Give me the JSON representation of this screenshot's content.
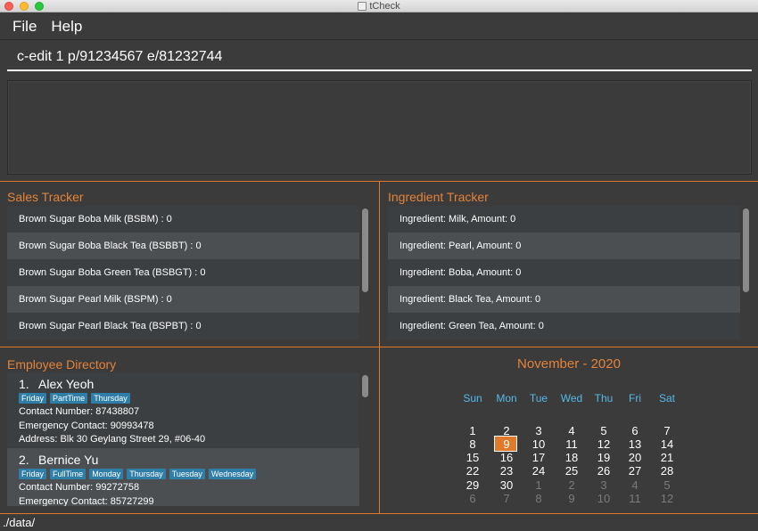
{
  "window": {
    "title": "tCheck"
  },
  "menu": {
    "file": "File",
    "help": "Help"
  },
  "command": {
    "value": "c-edit 1 p/91234567 e/81232744"
  },
  "sales": {
    "title": "Sales Tracker",
    "items": [
      "Brown Sugar Boba Milk (BSBM) : 0",
      "Brown Sugar Boba Black Tea (BSBBT) : 0",
      "Brown Sugar Boba Green Tea (BSBGT) : 0",
      "Brown Sugar Pearl Milk (BSPM) : 0",
      "Brown Sugar Pearl Black Tea (BSPBT) : 0"
    ]
  },
  "ingredients": {
    "title": "Ingredient Tracker",
    "items": [
      "Ingredient: Milk,  Amount: 0",
      "Ingredient: Pearl,  Amount: 0",
      "Ingredient: Boba,  Amount: 0",
      "Ingredient: Black Tea,  Amount: 0",
      "Ingredient: Green Tea,  Amount: 0"
    ]
  },
  "employees": {
    "title": "Employee Directory",
    "list": [
      {
        "index": "1.",
        "name": "Alex Yeoh",
        "tags": [
          "Friday",
          "PartTime",
          "Thursday"
        ],
        "contact": "Contact Number:  87438807",
        "emergency": "Emergency Contact:  90993478",
        "address": "Address:  Blk 30 Geylang Street 29, #06-40"
      },
      {
        "index": "2.",
        "name": "Bernice Yu",
        "tags": [
          "Friday",
          "FullTime",
          "Monday",
          "Thursday",
          "Tuesday",
          "Wednesday"
        ],
        "contact": "Contact Number:  99272758",
        "emergency": "Emergency Contact:  85727299"
      }
    ]
  },
  "calendar": {
    "month": "November - 2020",
    "weekdays": [
      "Sun",
      "Mon",
      "Tue",
      "Wed",
      "Thu",
      "Fri",
      "Sat"
    ],
    "weeks": [
      [
        "",
        "",
        "",
        "",
        "",
        "",
        ""
      ],
      [
        "1",
        "2",
        "3",
        "4",
        "5",
        "6",
        "7"
      ],
      [
        "8",
        "9",
        "10",
        "11",
        "12",
        "13",
        "14"
      ],
      [
        "15",
        "16",
        "17",
        "18",
        "19",
        "20",
        "21"
      ],
      [
        "22",
        "23",
        "24",
        "25",
        "26",
        "27",
        "28"
      ],
      [
        "29",
        "30",
        "1",
        "2",
        "3",
        "4",
        "5"
      ],
      [
        "6",
        "7",
        "8",
        "9",
        "10",
        "11",
        "12"
      ]
    ],
    "today": "9"
  },
  "status": {
    "path": "./data/"
  },
  "colors": {
    "accent": "#e07a2a",
    "tag": "#2f7ea8",
    "weekday": "#55b8e6"
  }
}
